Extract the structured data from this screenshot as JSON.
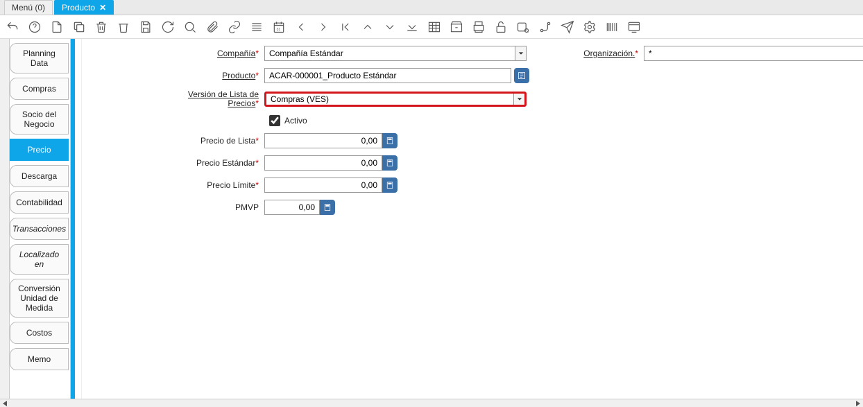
{
  "tabs": {
    "menu": "Menú (0)",
    "producto": "Producto",
    "close_glyph": "✕"
  },
  "sidenav": {
    "planning": "Planning Data",
    "compras": "Compras",
    "socio": "Socio del Negocio",
    "precio": "Precio",
    "descarga": "Descarga",
    "contabilidad": "Contabilidad",
    "transacciones": "Transacciones",
    "localizado": "Localizado en",
    "conversion": "Conversión Unidad de Medida",
    "costos": "Costos",
    "memo": "Memo"
  },
  "form": {
    "compania_label": "Compañía",
    "compania_value": "Compañía Estándar",
    "organizacion_label": "Organización.",
    "organizacion_value": "*",
    "producto_label": "Producto",
    "producto_value": "ACAR-000001_Producto Estándar",
    "version_label_l1": "Versión de Lista de",
    "version_label_l2": "Precios",
    "version_value": "Compras (VES)",
    "activo_label": "Activo",
    "precio_lista_label": "Precio de Lista",
    "precio_lista_value": "0,00",
    "precio_estandar_label": "Precio Estándar",
    "precio_estandar_value": "0,00",
    "precio_limite_label": "Precio Límite",
    "precio_limite_value": "0,00",
    "pmvp_label": "PMVP",
    "pmvp_value": "0,00"
  }
}
